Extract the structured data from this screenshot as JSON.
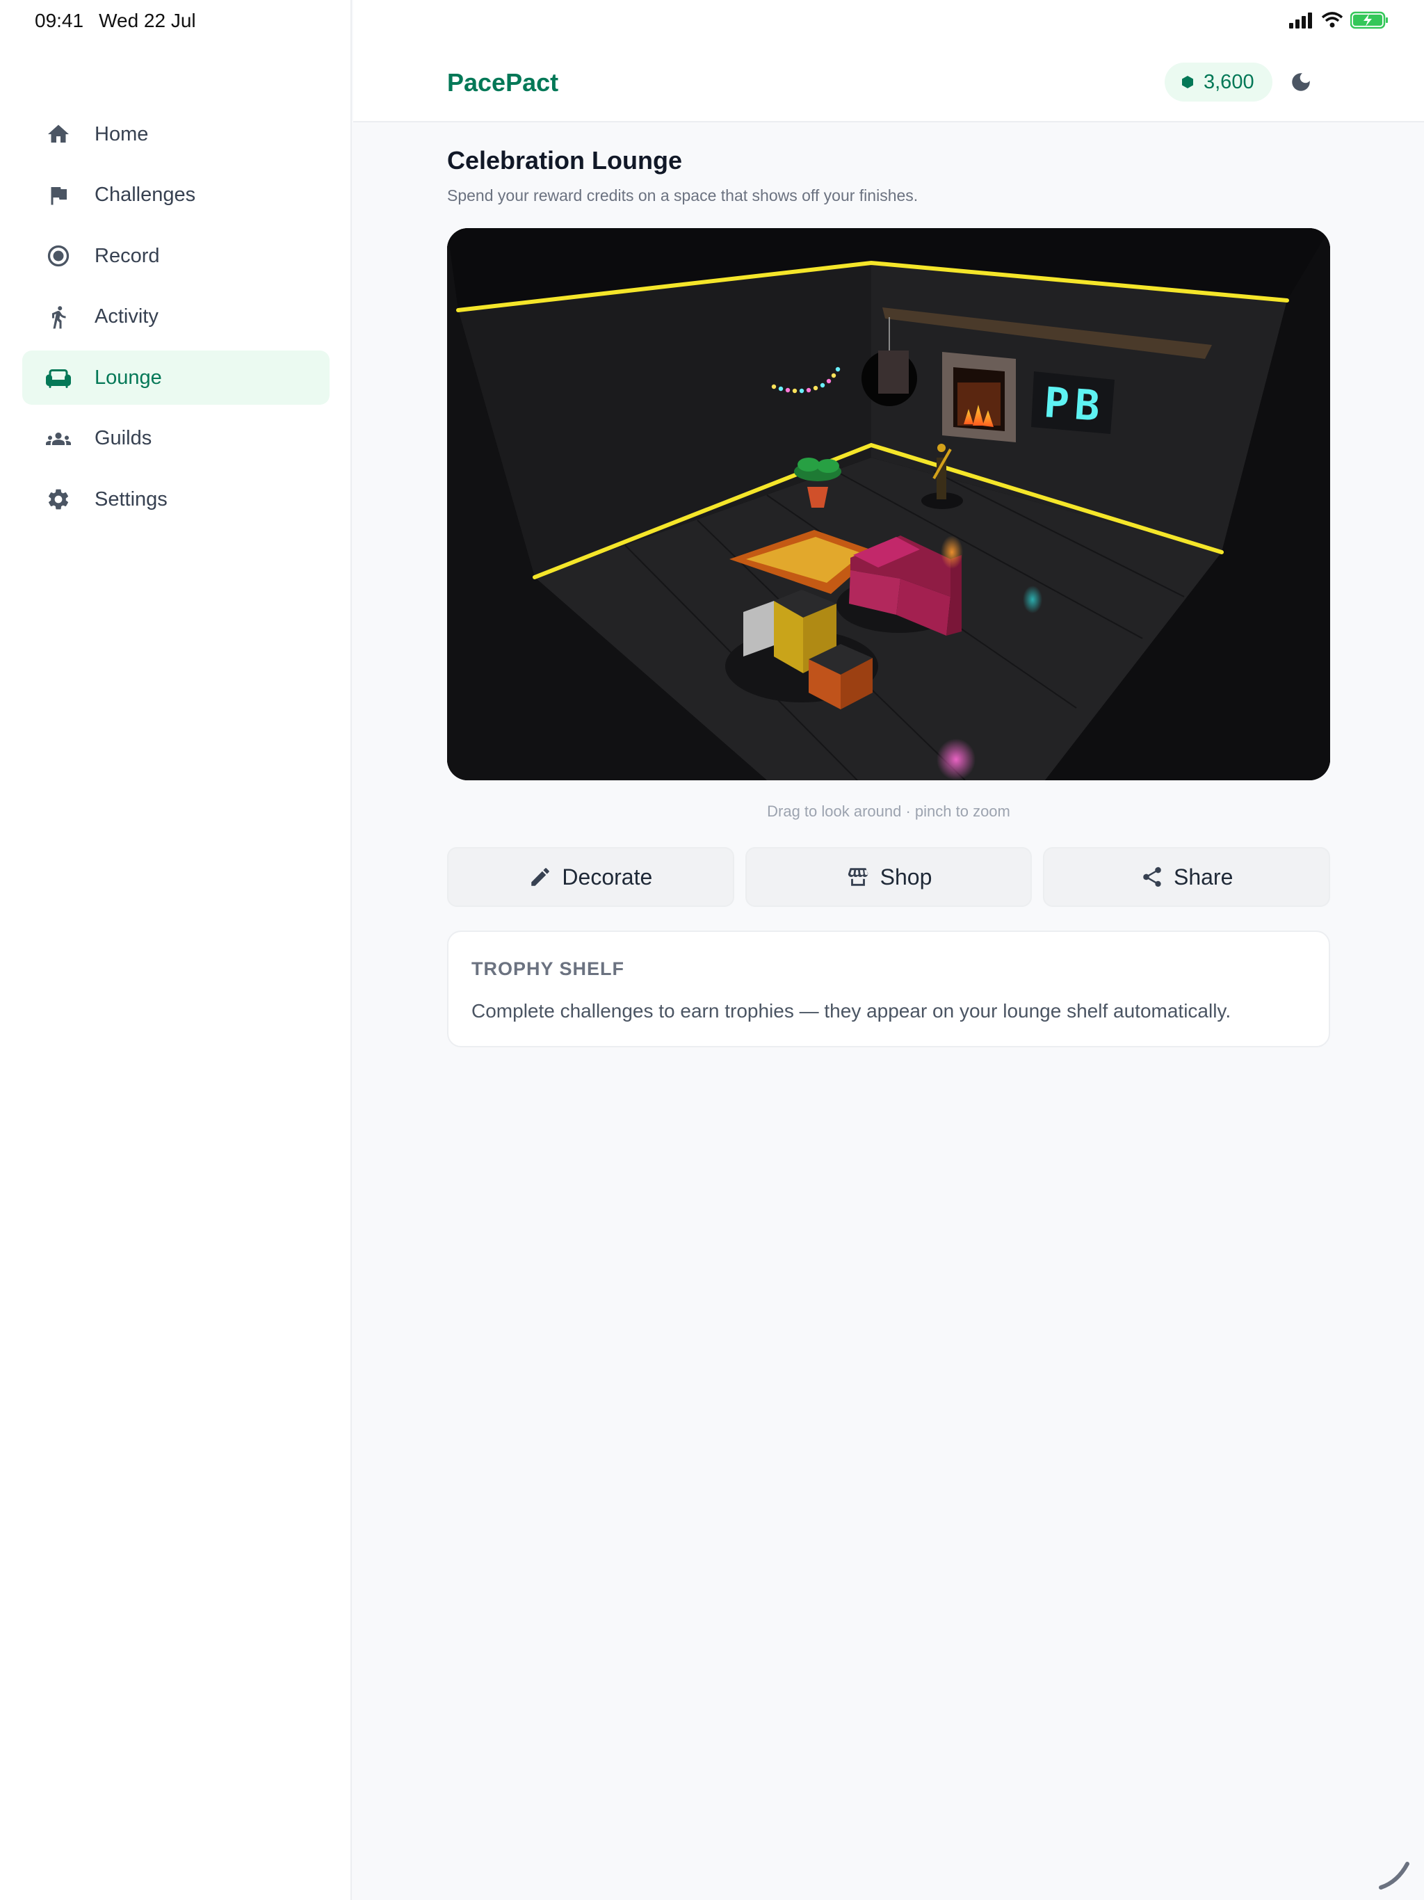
{
  "status": {
    "time": "09:41",
    "date": "Wed 22 Jul"
  },
  "app": {
    "brand": "PacePact",
    "credits": "3,600"
  },
  "nav": {
    "items": [
      {
        "label": "Home",
        "icon": "home-icon"
      },
      {
        "label": "Challenges",
        "icon": "flag-icon"
      },
      {
        "label": "Record",
        "icon": "record-icon"
      },
      {
        "label": "Activity",
        "icon": "running-icon"
      },
      {
        "label": "Lounge",
        "icon": "sofa-icon",
        "active": true
      },
      {
        "label": "Guilds",
        "icon": "group-icon"
      },
      {
        "label": "Settings",
        "icon": "gear-icon"
      }
    ]
  },
  "page": {
    "title": "Celebration Lounge",
    "subtitle": "Spend your reward credits on a space that shows off your finishes.",
    "scene_hint": "Drag to look around · pinch to zoom",
    "scene_sign": "PB"
  },
  "actions": {
    "decorate": "Decorate",
    "shop": "Shop",
    "share": "Share"
  },
  "trophy": {
    "title": "TROPHY SHELF",
    "text": "Complete challenges to earn trophies — they appear on your lounge shelf automatically."
  },
  "colors": {
    "accent": "#047857",
    "accent_bg": "#ebfaf1",
    "neon": "#f5e62a"
  }
}
